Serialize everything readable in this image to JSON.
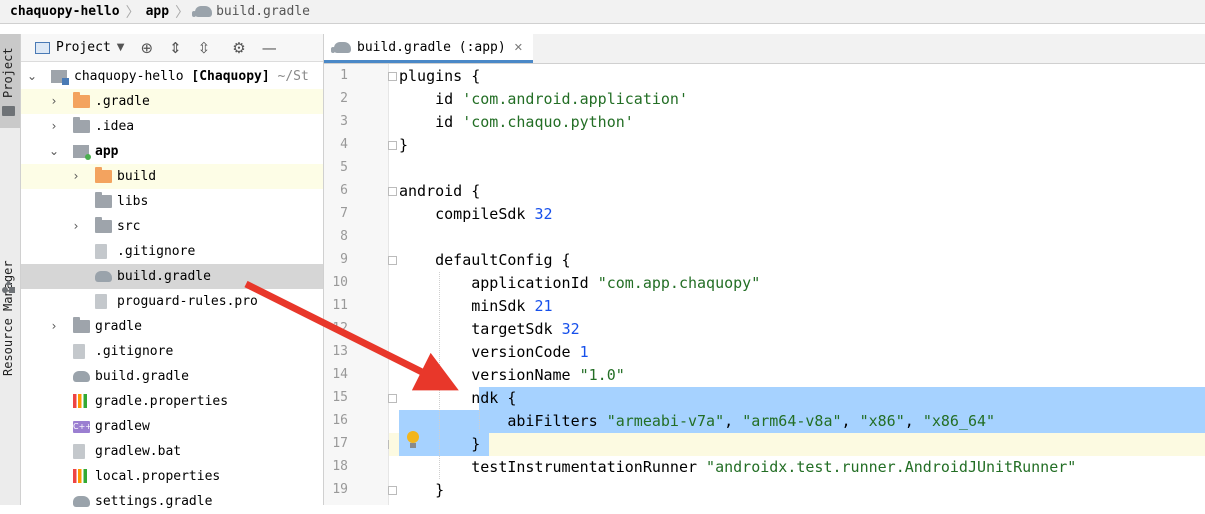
{
  "breadcrumb": {
    "project": "chaquopy-hello",
    "module": "app",
    "file": "build.gradle"
  },
  "sidebar": {
    "project_tab": "Project",
    "resource_tab": "Resource Manager"
  },
  "project_panel": {
    "view_selector": "Project",
    "root": {
      "name": "chaquopy-hello",
      "tag": "[Chaquopy]",
      "path": "~/St"
    },
    "items": [
      {
        "label": ".gradle",
        "icon": "folder-orange-icon"
      },
      {
        "label": ".idea",
        "icon": "folder-icon"
      },
      {
        "label": "app",
        "icon": "module-folder-icon"
      },
      {
        "label": "build",
        "icon": "folder-orange-icon"
      },
      {
        "label": "libs",
        "icon": "folder-icon"
      },
      {
        "label": "src",
        "icon": "folder-icon"
      },
      {
        "label": ".gitignore",
        "icon": "gitignore-file-icon"
      },
      {
        "label": "build.gradle",
        "icon": "gradle-elephant-icon"
      },
      {
        "label": "proguard-rules.pro",
        "icon": "text-file-icon"
      },
      {
        "label": "gradle",
        "icon": "folder-icon"
      },
      {
        "label": ".gitignore",
        "icon": "gitignore-file-icon"
      },
      {
        "label": "build.gradle",
        "icon": "gradle-elephant-icon"
      },
      {
        "label": "gradle.properties",
        "icon": "properties-file-icon"
      },
      {
        "label": "gradlew",
        "icon": "shell-script-icon"
      },
      {
        "label": "gradlew.bat",
        "icon": "text-file-icon"
      },
      {
        "label": "local.properties",
        "icon": "properties-file-icon"
      },
      {
        "label": "settings.gradle",
        "icon": "gradle-elephant-icon"
      }
    ]
  },
  "editor": {
    "tab_label": "build.gradle (:app)",
    "line_numbers": [
      "1",
      "2",
      "3",
      "4",
      "5",
      "6",
      "7",
      "8",
      "9",
      "10",
      "11",
      "12",
      "13",
      "14",
      "15",
      "16",
      "17",
      "18",
      "19"
    ],
    "lines": [
      {
        "t": "plugins {"
      },
      {
        "t": "    id ",
        "s": "'com.android.application'"
      },
      {
        "t": "    id ",
        "s": "'com.chaquo.python'"
      },
      {
        "t": "}"
      },
      {
        "t": ""
      },
      {
        "t": "android {"
      },
      {
        "t": "    compileSdk ",
        "n": "32"
      },
      {
        "t": ""
      },
      {
        "t": "    defaultConfig {"
      },
      {
        "t": "        applicationId ",
        "s": "\"com.app.chaquopy\""
      },
      {
        "t": "        minSdk ",
        "n": "21"
      },
      {
        "t": "        targetSdk ",
        "n": "32"
      },
      {
        "t": "        versionCode ",
        "n": "1"
      },
      {
        "t": "        versionName ",
        "s": "\"1.0\""
      },
      {
        "t": "        ndk {"
      },
      {
        "t": "            abiFilters ",
        "s": "\"armeabi-v7a\"",
        "rest": [
          ", ",
          "\"arm64-v8a\"",
          ", ",
          "\"x86\"",
          ", ",
          "\"x86_64\""
        ]
      },
      {
        "t": "        }"
      },
      {
        "t": "        testInstrumentationRunner ",
        "s": "\"androidx.test.runner.AndroidJUnitRunner\""
      },
      {
        "t": "    }"
      }
    ]
  },
  "colors": {
    "selection": "#a6d2ff",
    "string": "#236e25",
    "number": "#1750eb",
    "arrow": "#e8372a"
  }
}
